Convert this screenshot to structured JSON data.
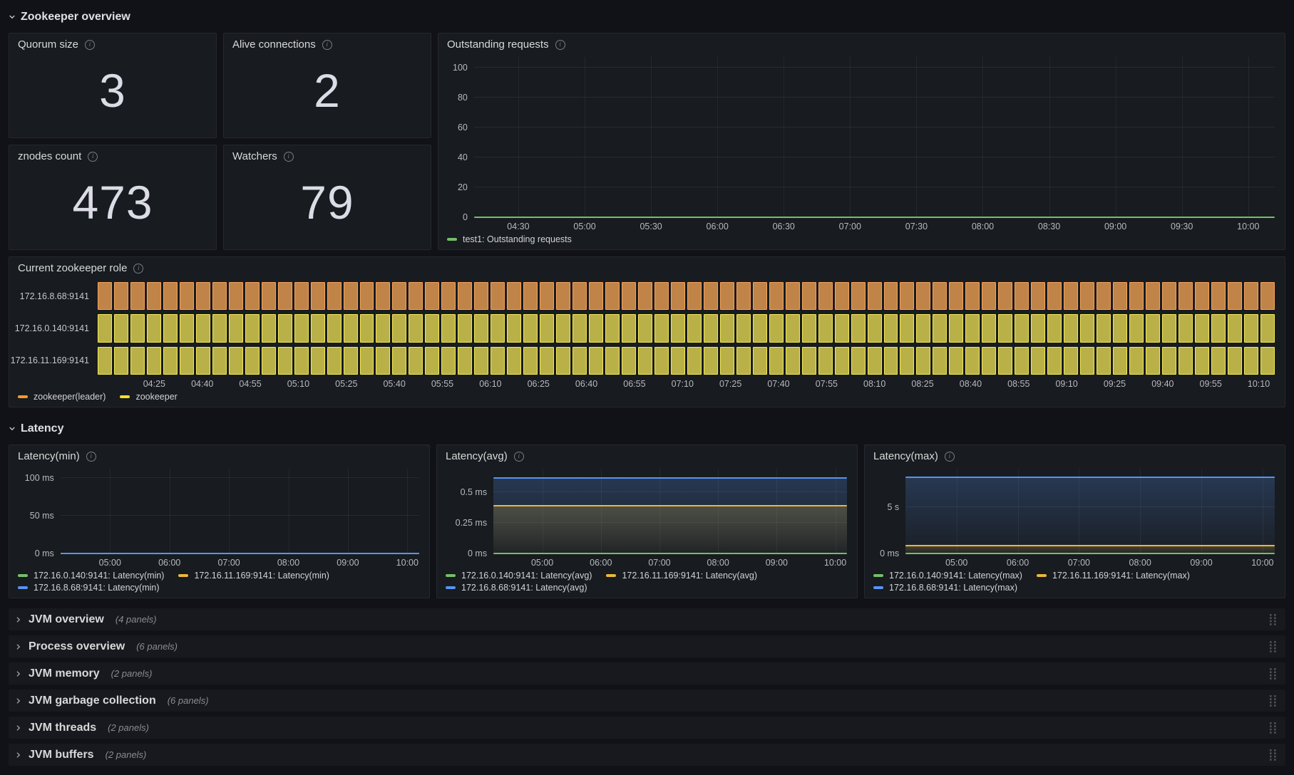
{
  "header_row": {
    "title": "Zookeeper overview"
  },
  "latency_row": {
    "title": "Latency"
  },
  "icons": {
    "row_expanded": "chevron-down-icon",
    "row_collapsed": "chevron-right-icon",
    "panel_info": "info-icon",
    "row_drag": "drag-handle-icon"
  },
  "stats": [
    {
      "title": "Quorum size",
      "value": "3"
    },
    {
      "title": "Alive connections",
      "value": "2"
    },
    {
      "title": "znodes count",
      "value": "473"
    },
    {
      "title": "Watchers",
      "value": "79"
    }
  ],
  "collapsed_rows": [
    {
      "title": "JVM overview",
      "count": "(4 panels)"
    },
    {
      "title": "Process overview",
      "count": "(6 panels)"
    },
    {
      "title": "JVM memory",
      "count": "(2 panels)"
    },
    {
      "title": "JVM garbage collection",
      "count": "(6 panels)"
    },
    {
      "title": "JVM threads",
      "count": "(2 panels)"
    },
    {
      "title": "JVM buffers",
      "count": "(2 panels)"
    }
  ],
  "colors": {
    "green": "#73bf69",
    "yellow": "#eab839",
    "blue": "#5794f2",
    "orange": "#ff9830",
    "role_yellow": "#fade2a",
    "panel_bg": "#181b1f",
    "page_bg": "#111217"
  },
  "chart_data": [
    {
      "id": "outstanding",
      "type": "line",
      "title": "Outstanding requests",
      "x_range": [
        "04:10",
        "10:12"
      ],
      "x_ticks": [
        "04:30",
        "05:00",
        "05:30",
        "06:00",
        "06:30",
        "07:00",
        "07:30",
        "08:00",
        "08:30",
        "09:00",
        "09:30",
        "10:00"
      ],
      "y_ticks": [
        {
          "v": 0,
          "label": "0"
        },
        {
          "v": 20,
          "label": "20"
        },
        {
          "v": 40,
          "label": "40"
        },
        {
          "v": 60,
          "label": "60"
        },
        {
          "v": 80,
          "label": "80"
        },
        {
          "v": 100,
          "label": "100"
        }
      ],
      "y_max": 107,
      "series": [
        {
          "name": "test1: Outstanding requests",
          "color": "#73bf69",
          "value": 0,
          "fill": false
        }
      ],
      "legend_wrap": 2
    },
    {
      "id": "role",
      "type": "status-history",
      "title": "Current zookeeper role",
      "x_range": [
        "04:10",
        "10:15"
      ],
      "x_ticks": [
        "04:25",
        "04:40",
        "04:55",
        "05:10",
        "05:25",
        "05:40",
        "05:55",
        "06:10",
        "06:25",
        "06:40",
        "06:55",
        "07:10",
        "07:25",
        "07:40",
        "07:55",
        "08:10",
        "08:25",
        "08:40",
        "08:55",
        "09:10",
        "09:25",
        "09:40",
        "09:55",
        "10:10"
      ],
      "bar_count": 72,
      "rows": [
        {
          "label": "172.16.8.68:9141",
          "state": "leader"
        },
        {
          "label": "172.16.0.140:9141",
          "state": "follower"
        },
        {
          "label": "172.16.11.169:9141",
          "state": "follower"
        }
      ],
      "states": {
        "leader": {
          "fill": "#c08448",
          "border": "#f7a35c"
        },
        "follower": {
          "fill": "#b9b148",
          "border": "#f3e955"
        }
      },
      "legend": [
        {
          "label": "zookeeper(leader)",
          "color": "#ff9830"
        },
        {
          "label": "zookeeper",
          "color": "#fade2a"
        }
      ],
      "legend_wrap": 2
    },
    {
      "id": "latency_min",
      "type": "line",
      "title": "Latency(min)",
      "x_range": [
        "04:10",
        "10:12"
      ],
      "x_ticks": [
        "05:00",
        "06:00",
        "07:00",
        "08:00",
        "09:00",
        "10:00"
      ],
      "y_ticks": [
        {
          "v": 0,
          "label": "0 ms"
        },
        {
          "v": 50,
          "label": "50 ms"
        },
        {
          "v": 100,
          "label": "100 ms"
        }
      ],
      "y_max": 112,
      "series": [
        {
          "name": "172.16.0.140:9141: Latency(min)",
          "color": "#73bf69",
          "value": 0,
          "fill": false
        },
        {
          "name": "172.16.11.169:9141: Latency(min)",
          "color": "#eab839",
          "value": 0,
          "fill": false
        },
        {
          "name": "172.16.8.68:9141: Latency(min)",
          "color": "#5794f2",
          "value": 0,
          "fill": false
        }
      ],
      "legend_wrap": 2
    },
    {
      "id": "latency_avg",
      "type": "line",
      "title": "Latency(avg)",
      "x_range": [
        "04:10",
        "10:12"
      ],
      "x_ticks": [
        "05:00",
        "06:00",
        "07:00",
        "08:00",
        "09:00",
        "10:00"
      ],
      "y_ticks": [
        {
          "v": 0,
          "label": "0 ms"
        },
        {
          "v": 0.25,
          "label": "0.25 ms"
        },
        {
          "v": 0.5,
          "label": "0.5 ms"
        }
      ],
      "y_max": 0.69,
      "series": [
        {
          "name": "172.16.0.140:9141: Latency(avg)",
          "color": "#73bf69",
          "value": 0,
          "fill": false
        },
        {
          "name": "172.16.11.169:9141: Latency(avg)",
          "color": "#eab839",
          "value": 0.39,
          "fill": true
        },
        {
          "name": "172.16.8.68:9141: Latency(avg)",
          "color": "#5794f2",
          "value": 0.615,
          "fill": true
        }
      ],
      "legend_wrap": 2
    },
    {
      "id": "latency_max",
      "type": "line",
      "title": "Latency(max)",
      "x_range": [
        "04:10",
        "10:12"
      ],
      "x_ticks": [
        "05:00",
        "06:00",
        "07:00",
        "08:00",
        "09:00",
        "10:00"
      ],
      "y_ticks": [
        {
          "v": 0,
          "label": "0 ms"
        },
        {
          "v": 5,
          "label": "5 s"
        }
      ],
      "y_max": 9.15,
      "series": [
        {
          "name": "172.16.0.140:9141: Latency(max)",
          "color": "#73bf69",
          "value": 0,
          "fill": false
        },
        {
          "name": "172.16.11.169:9141: Latency(max)",
          "color": "#eab839",
          "value": 0.85,
          "fill": true
        },
        {
          "name": "172.16.8.68:9141: Latency(max)",
          "color": "#5794f2",
          "value": 8.2,
          "fill": true
        }
      ],
      "legend_wrap": 2
    }
  ]
}
